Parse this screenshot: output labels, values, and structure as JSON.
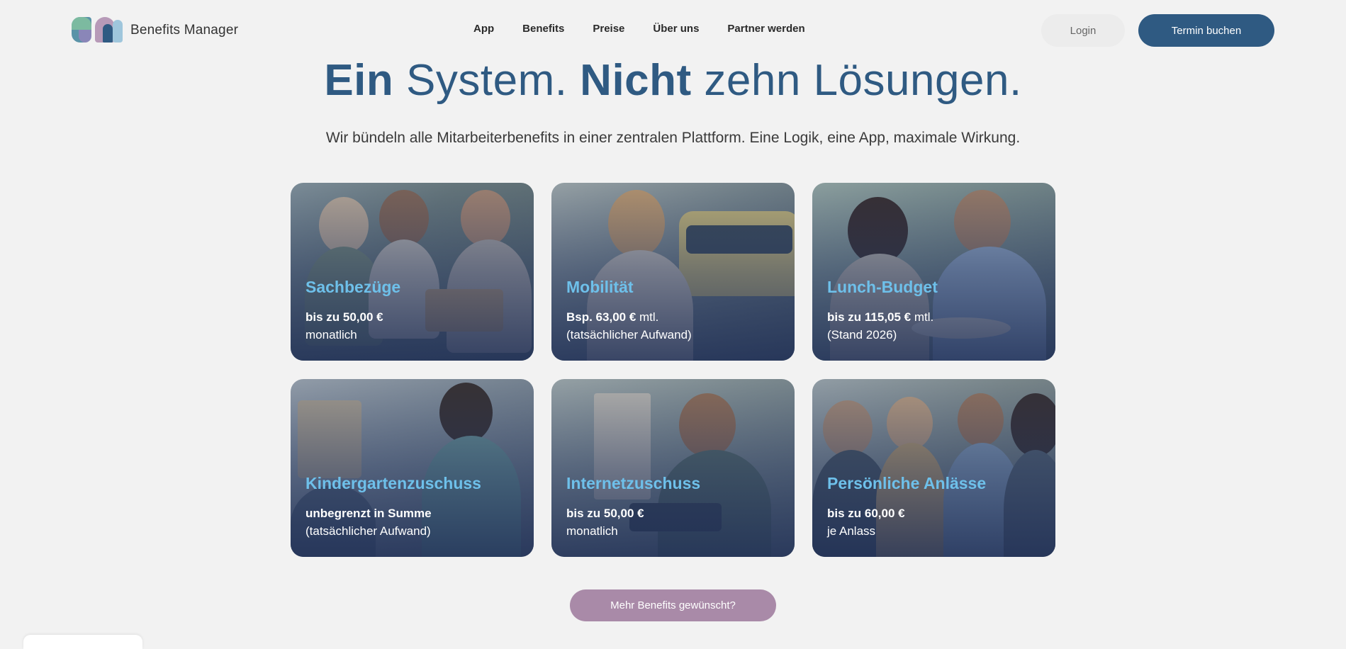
{
  "brand": {
    "name": "Benefits Manager"
  },
  "nav": {
    "items": [
      {
        "label": "App"
      },
      {
        "label": "Benefits"
      },
      {
        "label": "Preise"
      },
      {
        "label": "Über uns"
      },
      {
        "label": "Partner werden"
      }
    ],
    "login_label": "Login",
    "cta_label": "Termin buchen"
  },
  "hero": {
    "title_part1_bold": "Ein",
    "title_part2": " System. ",
    "title_part3_bold": "Nicht",
    "title_part4": " zehn Lösungen.",
    "subtitle": "Wir bündeln alle Mitarbeiterbenefits in einer zentralen Plattform. Eine Logik, eine App, maximale Wirkung."
  },
  "cards": [
    {
      "title": "Sachbezüge",
      "line1_bold": "bis zu 50,00 €",
      "line1_rest": "",
      "line2": "monatlich"
    },
    {
      "title": "Mobilität",
      "line1_bold": "Bsp. 63,00 €",
      "line1_rest": " mtl.",
      "line2": "(tatsächlicher Aufwand)"
    },
    {
      "title": "Lunch-Budget",
      "line1_bold": "bis zu 115,05 €",
      "line1_rest": " mtl.",
      "line2": "(Stand 2026)"
    },
    {
      "title": "Kindergartenzuschuss",
      "line1_bold": "unbegrenzt in Summe",
      "line1_rest": "",
      "line2": "(tatsächlicher Aufwand)"
    },
    {
      "title": "Internetzuschuss",
      "line1_bold": "bis zu 50,00 €",
      "line1_rest": "",
      "line2": "monatlich"
    },
    {
      "title": "Persönliche Anlässe",
      "line1_bold": "bis zu 60,00 €",
      "line1_rest": "",
      "line2": "je Anlass"
    }
  ],
  "more_button_label": "Mehr Benefits gewünscht?",
  "colors": {
    "primary": "#2f5a82",
    "card_title": "#6ec0ea",
    "secondary_button": "#a98aa8",
    "background": "#f2f2f2"
  }
}
